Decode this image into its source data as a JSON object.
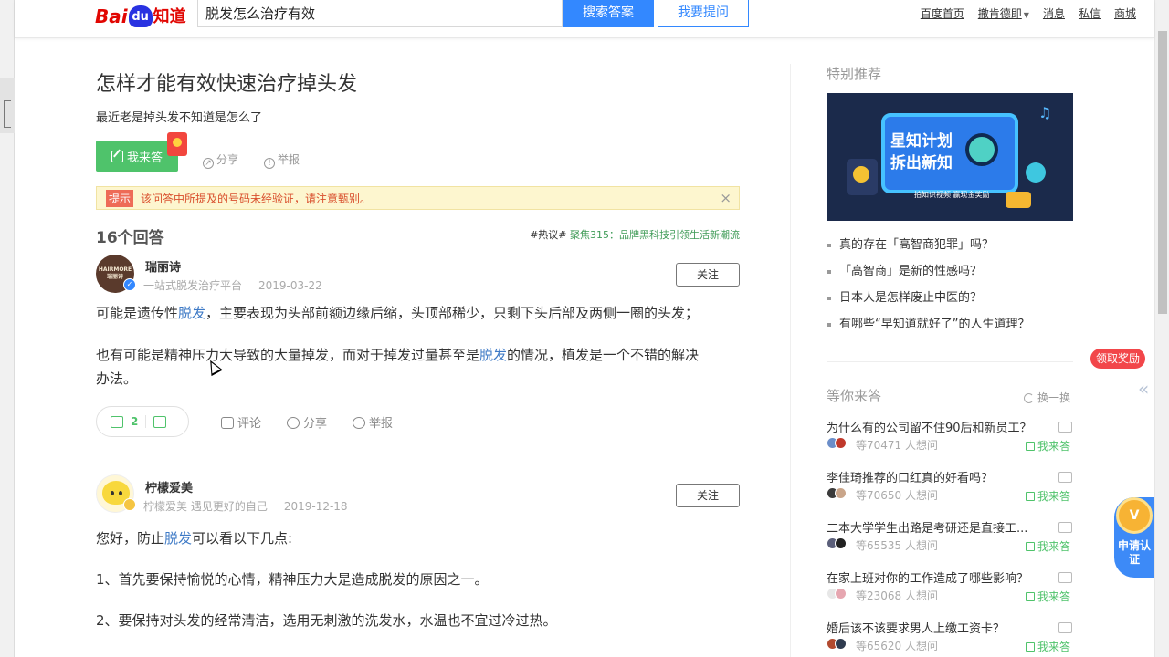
{
  "header": {
    "logo_bai": "Bai",
    "logo_du": "du",
    "logo_zhidao": "知道",
    "search_value": "脱发怎么治疗有效",
    "search_button": "搜索答案",
    "ask_button": "我要提问",
    "nav": [
      "百度首页",
      "撤肯德即",
      "消息",
      "私信",
      "商城"
    ]
  },
  "question": {
    "title": "怎样才能有效快速治疗掉头发",
    "description": "最近老是掉头发不知道是怎么了",
    "answer_button": "我来答",
    "share": "分享",
    "report": "举报"
  },
  "tip": {
    "tag": "提示",
    "text": "该问答中所提及的号码未经验证，请注意甄别。",
    "close": "×"
  },
  "answers_count": "16个回答",
  "hot_topic": {
    "tag": "#热议#",
    "link": "聚焦315：品牌黑科技引领生活新潮流"
  },
  "answers": [
    {
      "avatar_text": "HAIRMORE 瑞丽诗",
      "name": "瑞丽诗",
      "meta": "一站式脱发治疗平台",
      "date": "2019-03-22",
      "follow": "关注",
      "p1_a": "可能是遗传性",
      "p1_kw": "脱发",
      "p1_b": "，主要表现为头部前额边缘后缩，头顶部稀少，只剩下头后部及两侧一圈的头发；",
      "p2_a": "也有可能是精神压力大导致的大量掉发，而对于掉发过量甚至是",
      "p2_kw": "脱发",
      "p2_b": "的情况，植发是一个不错的解决",
      "p2_c": "办法。",
      "likes": "2",
      "comment": "评论",
      "share": "分享",
      "report": "举报"
    },
    {
      "name": "柠檬爱美",
      "meta": "柠檬爱美 遇见更好的自己",
      "date": "2019-12-18",
      "follow": "关注",
      "p1_a": "您好，防止",
      "p1_kw": "脱发",
      "p1_b": "可以看以下几点:",
      "p2": "1、首先要保持愉悦的心情，精神压力大是造成脱发的原因之一。",
      "p3": "2、要保持对头发的经常清洁，选用无刺激的洗发水，水温也不宜过冷过热。"
    }
  ],
  "sidebar": {
    "special_title": "特别推荐",
    "banner": {
      "line1": "星知计划",
      "line2": "拆出新知",
      "line3": "拍知识视频 赢现金奖励"
    },
    "recommend": [
      "真的存在「高智商犯罪」吗？",
      "「高智商」是新的性感吗？",
      "日本人是怎样废止中医的？",
      "有哪些“早知道就好了”的人生道理？"
    ],
    "waiting_title": "等你来答",
    "refresh": "换一换",
    "waiting": [
      {
        "q": "为什么有的公司留不住90后和新员工？",
        "count": "等70471 人想问",
        "answer": "我来答"
      },
      {
        "q": "李佳琦推荐的口红真的好看吗？",
        "count": "等70650 人想问",
        "answer": "我来答"
      },
      {
        "q": "二本大学学生出路是考研还是直接工...",
        "count": "等65535 人想问",
        "answer": "我来答"
      },
      {
        "q": "在家上班对你的工作造成了哪些影响？",
        "count": "等23068 人想问",
        "answer": "我来答"
      },
      {
        "q": "婚后该不该要求男人上缴工资卡？",
        "count": "等65620 人想问",
        "answer": "我来答"
      }
    ]
  },
  "floating": {
    "reward": "领取奖励",
    "collapse": "«",
    "cert_medal": "V",
    "cert": "申请认证"
  }
}
